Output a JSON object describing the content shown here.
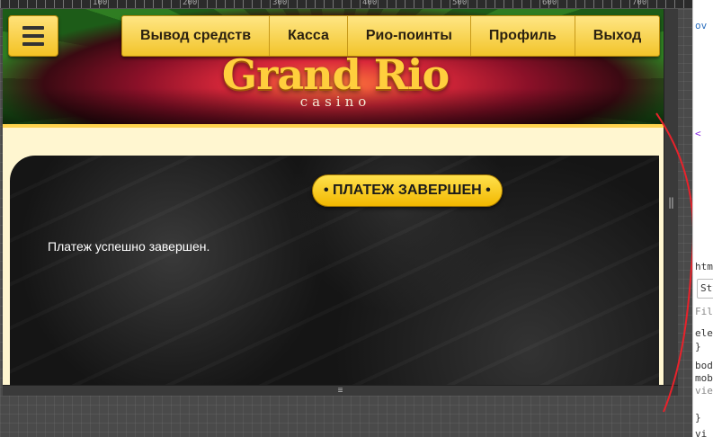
{
  "ruler": {
    "marks": [
      "100",
      "200",
      "300",
      "400",
      "500",
      "600",
      "700"
    ]
  },
  "nav": {
    "menu_icon": "hamburger-icon",
    "items": [
      {
        "label": "Вывод средств"
      },
      {
        "label": "Касса"
      },
      {
        "label": "Рио-поинты"
      },
      {
        "label": "Профиль"
      },
      {
        "label": "Выход"
      }
    ]
  },
  "logo": {
    "main": "Grand Rio",
    "sub": "casino"
  },
  "content": {
    "badge": "• ПЛАТЕЖ ЗАВЕРШЕН •",
    "message": "Платеж успешно завершен."
  },
  "devtools": {
    "lines": [
      "ov",
      "<",
      "htm",
      "Sty",
      "Filte",
      "ele",
      "}",
      "bod",
      "mob",
      "vie",
      "}",
      "vi"
    ]
  },
  "colors": {
    "accent": "#ffd34d",
    "annotation": "#e8222b",
    "page_background": "#fff6d0"
  }
}
